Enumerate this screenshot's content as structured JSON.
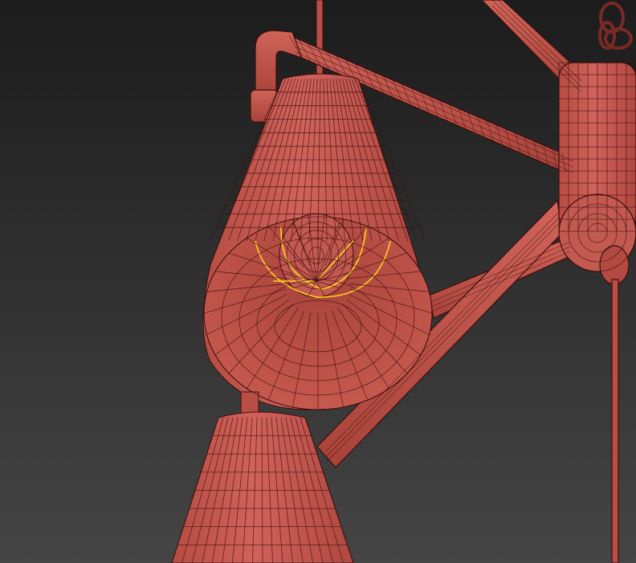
{
  "viewport": {
    "background_top": "#1c1c1c",
    "background_bottom": "#454545"
  },
  "model": {
    "mesh_fill": "#c7574c",
    "mesh_shade": "#a8433a",
    "mesh_inner": "#b54a40",
    "wire_color": "#3a0e0e",
    "selection_color": "#ffd21a",
    "objects": [
      "shade-upper",
      "shade-lower",
      "bulb-upper",
      "center-hub",
      "arm-tubes",
      "suspension-rods",
      "chain-link",
      "filament-selection"
    ]
  }
}
